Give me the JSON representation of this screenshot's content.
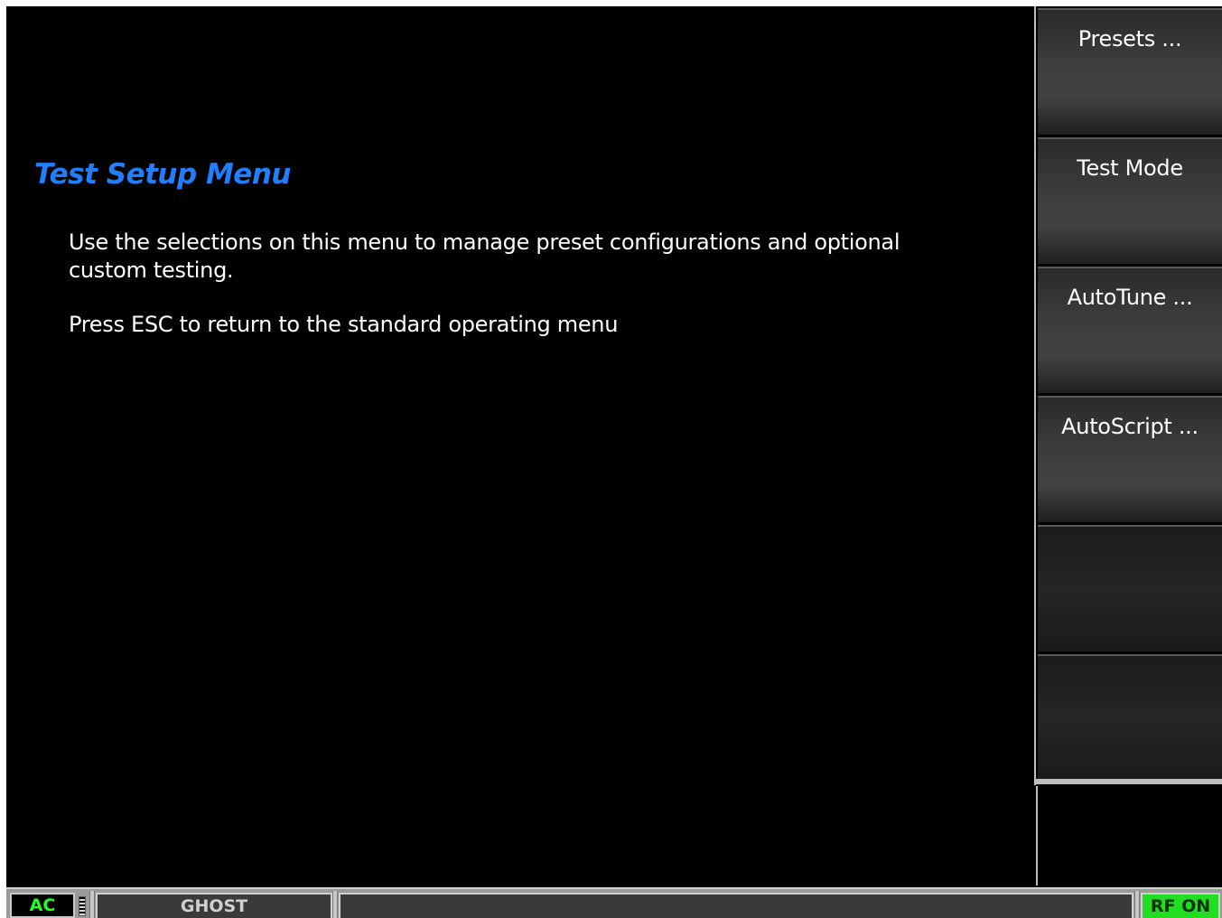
{
  "main": {
    "title": "Test Setup Menu",
    "description_1": "Use the selections on this menu to manage preset configurations and optional custom testing.",
    "description_2": "Press ESC to return to the standard operating menu"
  },
  "softkeys": [
    {
      "label": "Presets ..."
    },
    {
      "label": "Test Mode"
    },
    {
      "label": "AutoTune ..."
    },
    {
      "label": "AutoScript ..."
    },
    {
      "label": ""
    },
    {
      "label": ""
    }
  ],
  "status_bar": {
    "power_source": "AC",
    "mode_label": "GHOST",
    "message": "",
    "rf_status": "RF ON"
  },
  "colors": {
    "title": "#1f7fff",
    "ac_text": "#22ff22",
    "rf_on_bg": "#22dd22"
  },
  "icons": {
    "battery": "battery-level-icon"
  }
}
